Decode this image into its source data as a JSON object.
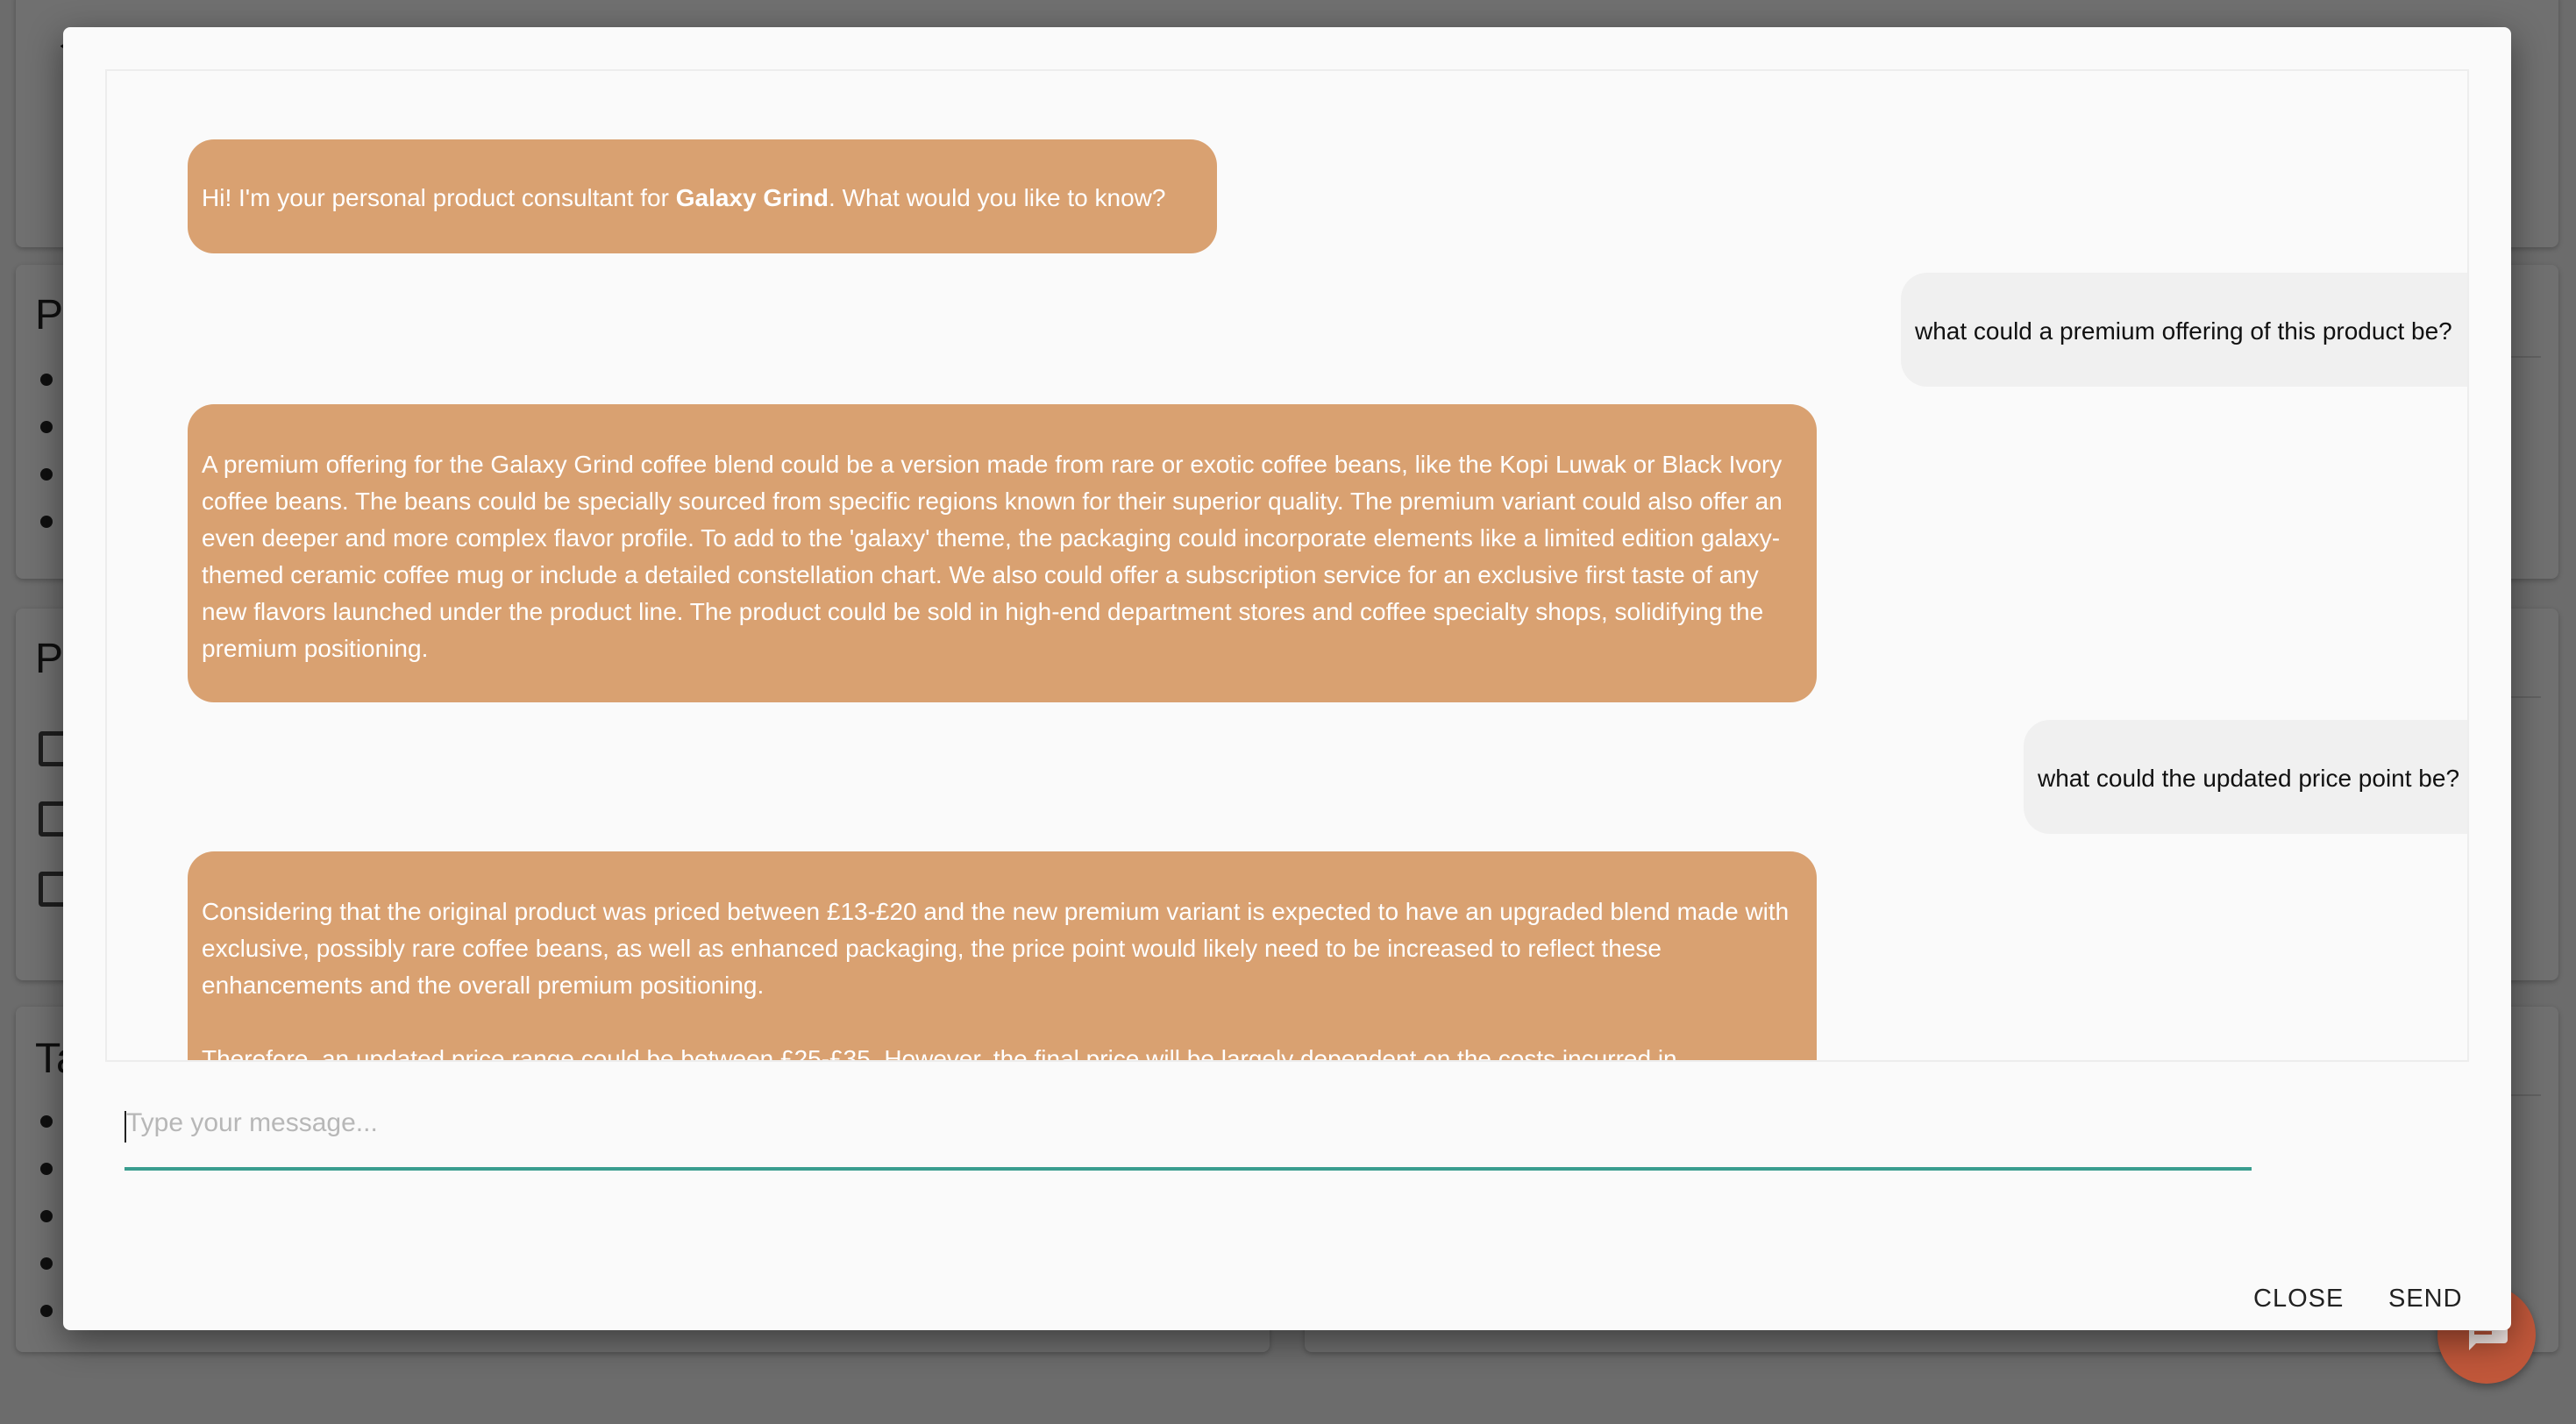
{
  "background": {
    "cards": [
      {
        "heading": "P"
      },
      {
        "heading": "P"
      },
      {
        "heading": "Ta"
      }
    ]
  },
  "dialog": {
    "messages": [
      {
        "role": "bot",
        "text_before": "Hi! I'm your personal product consultant for ",
        "bold": "Galaxy Grind",
        "text_after": ". What would you like to know?"
      },
      {
        "role": "user",
        "text": "what could a premium offering of this product be?"
      },
      {
        "role": "bot",
        "text": "A premium offering for the Galaxy Grind coffee blend could be a version made from rare or exotic coffee beans, like the Kopi Luwak or Black Ivory coffee beans. The beans could be specially sourced from specific regions known for their superior quality. The premium variant could also offer an even deeper and more complex flavor profile. To add to the 'galaxy' theme, the packaging could incorporate elements like a limited edition galaxy-themed ceramic coffee mug or include a detailed constellation chart. We also could offer a subscription service for an exclusive first taste of any new flavors launched under the product line. The product could be sold in high-end department stores and coffee specialty shops, solidifying the premium positioning."
      },
      {
        "role": "user",
        "text": "what could the updated price point be?"
      },
      {
        "role": "bot",
        "text": "Considering that the original product was priced between £13-£20 and the new premium variant is expected to have an upgraded blend made with exclusive, possibly rare coffee beans, as well as enhanced packaging, the price point would likely need to be increased to reflect these enhancements and the overall premium positioning.\n\nTherefore, an updated price range could be between £25-£35. However, the final price will be largely dependent on the costs incurred in"
      }
    ],
    "input": {
      "placeholder": "Type your message...",
      "value": ""
    },
    "close_label": "CLOSE",
    "send_label": "SEND"
  },
  "colors": {
    "bot_bubble": "#d9a171",
    "user_bubble": "#f0f0f0",
    "input_underline": "#3a9d8f",
    "fab": "#c0573a"
  },
  "icons": {
    "back": "arrow-left-icon",
    "fab": "chat-icon"
  }
}
